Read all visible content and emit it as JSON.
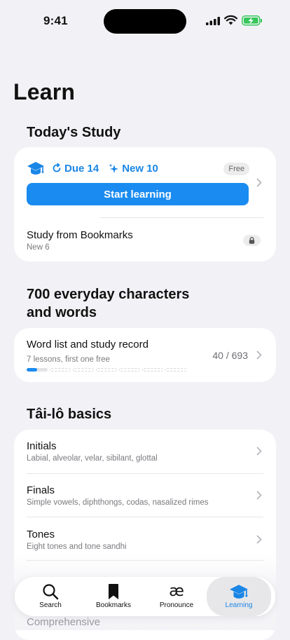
{
  "status": {
    "time": "9:41"
  },
  "page_title": "Learn",
  "today": {
    "title": "Today's Study",
    "due_label": "Due 14",
    "new_label": "New 10",
    "badge": "Free",
    "start_button": "Start learning",
    "bookmarks_title": "Study from Bookmarks",
    "bookmarks_sub": "New 6"
  },
  "everyday": {
    "title_line1": "700 everyday characters",
    "title_line2": "and words",
    "row_title": "Word list and study record",
    "row_sub": "7 lessons, first one free",
    "count": "40 / 693",
    "progress_first_fraction": 0.5
  },
  "basics": {
    "title": "Tâi-lô basics",
    "items": [
      {
        "title": "Initials",
        "sub": "Labial, alveolar, velar, sibilant, glottal"
      },
      {
        "title": "Finals",
        "sub": "Simple vowels, diphthongs, codas, nasalized rimes"
      },
      {
        "title": "Tones",
        "sub": "Eight tones and tone sandhi"
      }
    ],
    "partial_title": "Comprehensive"
  },
  "tabs": [
    {
      "label": "Search",
      "icon": "search-icon"
    },
    {
      "label": "Bookmarks",
      "icon": "bookmark-icon"
    },
    {
      "label": "Pronounce",
      "icon": "ae-icon"
    },
    {
      "label": "Learning",
      "icon": "graduation-cap-icon"
    }
  ],
  "colors": {
    "accent": "#1a8bf0",
    "background": "#f2f2f6"
  }
}
